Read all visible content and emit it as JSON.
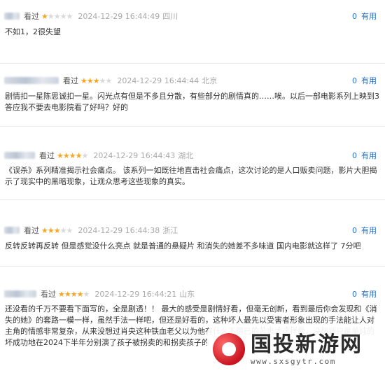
{
  "reviews": [
    {
      "status": "看过",
      "rating": 1,
      "time": "2024-12-29 16:44:49",
      "location": "四川",
      "useful_count": "0",
      "useful_label": "有用",
      "text": "不如1，2很失望"
    },
    {
      "status": "看过",
      "rating": 3,
      "time": "2024-12-29 16:44:44",
      "location": "北京",
      "useful_count": "0",
      "useful_label": "有用",
      "text": "剧情扣一星陈思诚扣一星。闪光点有但是不多且分散，有些部分的剧情真的……唉。以后一部电影系列上映到3答应我不要去电影院看了好吗？好的"
    },
    {
      "status": "看过",
      "rating": 4,
      "time": "2024-12-29 16:44:43",
      "location": "湖北",
      "useful_count": "0",
      "useful_label": "有用",
      "text": "《误杀》系列精准揭示社会痛点。 该系列一如既往地直击社会痛点，这次讨论的是人口贩卖问题，影片大胆揭示了现实中的黑暗现象，让观众思考这些现象的真实。"
    },
    {
      "status": "看过",
      "rating": 3,
      "time": "2024-12-29 16:44:38",
      "location": "浙江",
      "useful_count": "0",
      "useful_label": "有用",
      "text": "反转反转再反转 但是感觉没什么亮点 就是普通的悬疑片 和消失的她差不多味道 国内电影就这样了 7分吧"
    },
    {
      "status": "看过",
      "rating": 4,
      "time": "2024-12-29 16:44:21",
      "location": "山东",
      "useful_count": "0",
      "useful_label": "有用",
      "text": "还没看的千万不要看下面写的，全是剧透！！ 最大的感受是剧情好看，但毫无创新，看到最后你会发现和《消失的她》的套路一模一样，虽然手法一样吧，但还是好看的，这种坏人最先以受害者形象出现的手法能让人对主角的情感非常复杂，从来没想过肖央这种铁血老父以为他有什么不得已的苦衷才这样做，没想到只是单纯的坏成功地在2024下半年分别演了孩子被拐卖的和拐卖孩子的"
    }
  ],
  "watermark": {
    "title": "国投新游网",
    "url": "www.sxsgytr.com"
  }
}
